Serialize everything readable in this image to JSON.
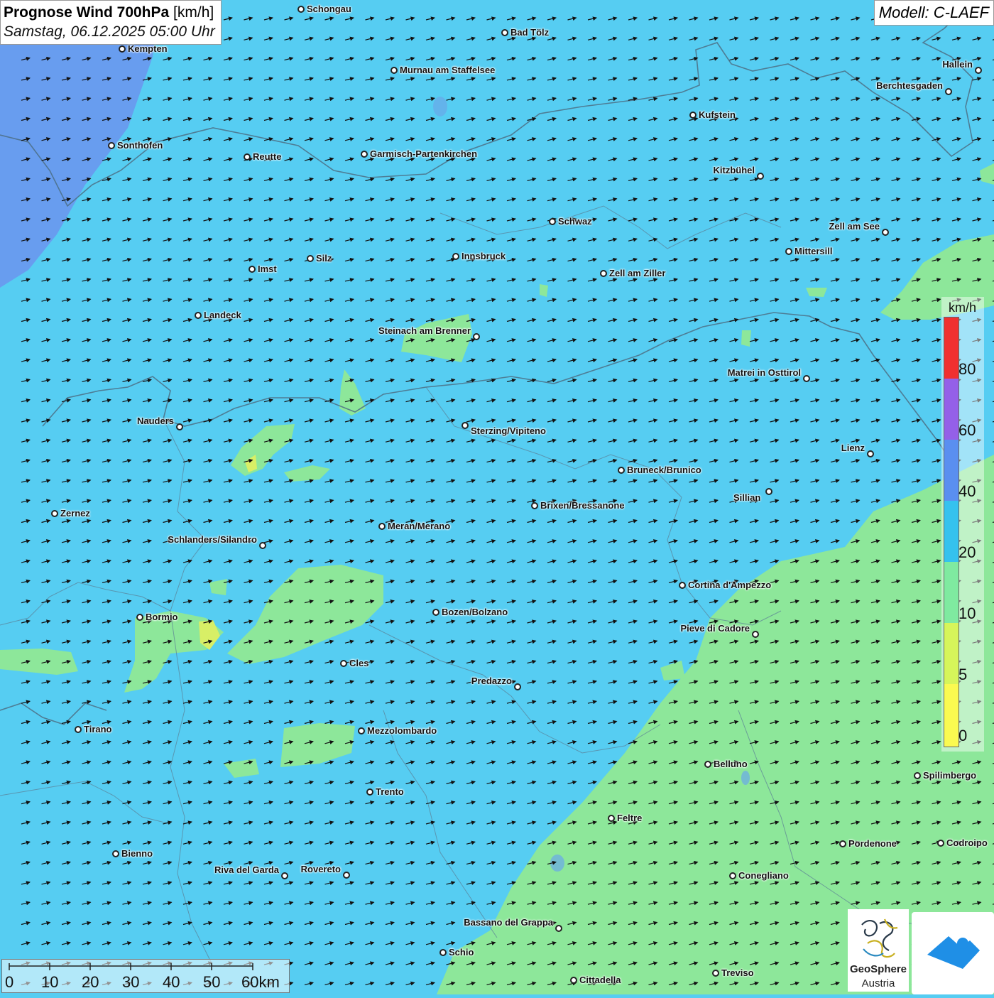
{
  "header": {
    "title_bold": "Prognose Wind 700hPa",
    "title_unit": "[km/h]",
    "datetime": "Samstag, 06.12.2025 05:00 Uhr",
    "model": "Modell: C-LAEF"
  },
  "legend": {
    "unit": "km/h",
    "ticks": [
      "80",
      "60",
      "40",
      "20",
      "10",
      "5",
      "0"
    ],
    "colors": [
      "#f03030",
      "#9460e8",
      "#5a8ff0",
      "#35c2ee",
      "#7feaa0",
      "#d6f55a",
      "#fafa50"
    ]
  },
  "scale_bar": {
    "labels": [
      "0",
      "10",
      "20",
      "30",
      "40",
      "50",
      "60km"
    ]
  },
  "logos": {
    "geosphere_line1": "GeoSphere",
    "geosphere_line2": "Austria"
  },
  "colors": {
    "wind_20_40": "#56cdf2",
    "wind_10_20": "#8de79a",
    "wind_5_10": "#d8ef66",
    "wind_40_60": "#6a98ee"
  },
  "wind_direction": "west-southwest, pointing east-northeast",
  "cities": [
    {
      "name": "Schongau"
    },
    {
      "name": "Bad Tölz"
    },
    {
      "name": "Kempten"
    },
    {
      "name": "Murnau am Staffelsee"
    },
    {
      "name": "Hallein"
    },
    {
      "name": "Berchtesgaden"
    },
    {
      "name": "Kufstein"
    },
    {
      "name": "Sonthofen"
    },
    {
      "name": "Reutte"
    },
    {
      "name": "Garmisch-Partenkirchen"
    },
    {
      "name": "Kitzbühel"
    },
    {
      "name": "Schwaz"
    },
    {
      "name": "Zell am See"
    },
    {
      "name": "Mittersill"
    },
    {
      "name": "Innsbruck"
    },
    {
      "name": "Imst"
    },
    {
      "name": "Silz"
    },
    {
      "name": "Zell am Ziller"
    },
    {
      "name": "Landeck"
    },
    {
      "name": "Steinach am Brenner"
    },
    {
      "name": "Matrei in Osttirol"
    },
    {
      "name": "Nauders"
    },
    {
      "name": "Sterzing/Vipiteno"
    },
    {
      "name": "Lienz"
    },
    {
      "name": "Bruneck/Brunico"
    },
    {
      "name": "Sillian"
    },
    {
      "name": "Zernez"
    },
    {
      "name": "Brixen/Bressanone"
    },
    {
      "name": "Meran/Merano"
    },
    {
      "name": "Schlanders/Silandro"
    },
    {
      "name": "Cortina d'Ampezzo"
    },
    {
      "name": "Bormio"
    },
    {
      "name": "Bozen/Bolzano"
    },
    {
      "name": "Pieve di Cadore"
    },
    {
      "name": "Cles"
    },
    {
      "name": "Predazzo"
    },
    {
      "name": "Tirano"
    },
    {
      "name": "Mezzolombardo"
    },
    {
      "name": "Belluno"
    },
    {
      "name": "Spilimbergo"
    },
    {
      "name": "Trento"
    },
    {
      "name": "Feltre"
    },
    {
      "name": "Pordenone"
    },
    {
      "name": "Codroipo"
    },
    {
      "name": "Bienno"
    },
    {
      "name": "Riva del Garda"
    },
    {
      "name": "Rovereto"
    },
    {
      "name": "Conegliano"
    },
    {
      "name": "Bassano del Grappa"
    },
    {
      "name": "Schio"
    },
    {
      "name": "Treviso"
    },
    {
      "name": "Cittadella"
    }
  ]
}
